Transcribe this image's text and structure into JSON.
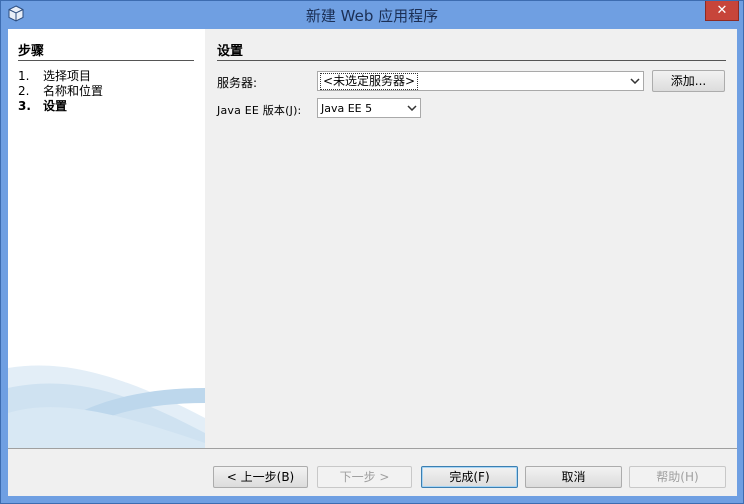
{
  "window": {
    "title": "新建 Web 应用程序",
    "close_glyph": "✕"
  },
  "steps": {
    "title": "步骤",
    "items": [
      {
        "num": "1.",
        "label": "选择项目",
        "current": false
      },
      {
        "num": "2.",
        "label": "名称和位置",
        "current": false
      },
      {
        "num": "3.",
        "label": "设置",
        "current": true
      }
    ]
  },
  "settings": {
    "title": "设置",
    "server_label": "服务器:",
    "server_value": "<未选定服务器>",
    "add_button": "添加...",
    "javaee_label": "Java EE 版本(J):",
    "javaee_value": "Java EE 5"
  },
  "buttons": {
    "back": "< 上一步(B)",
    "next": "下一步 >",
    "finish": "完成(F)",
    "cancel": "取消",
    "help": "帮助(H)"
  },
  "colors": {
    "titlebar": "#6f9fe2",
    "close": "#c7453a",
    "panel_bg": "#f0f0f0"
  },
  "icons": {
    "app": "cube-icon",
    "close": "close-icon",
    "dropdown": "chevron-down-icon"
  }
}
